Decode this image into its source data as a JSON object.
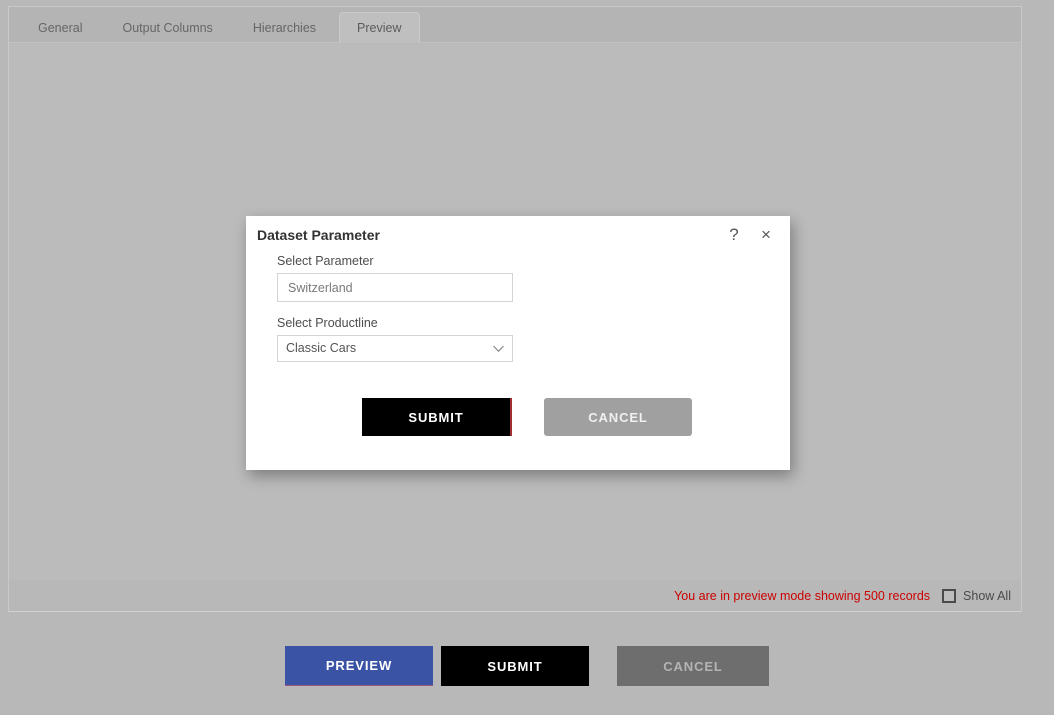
{
  "tabs": [
    {
      "label": "General",
      "active": false
    },
    {
      "label": "Output Columns",
      "active": false
    },
    {
      "label": "Hierarchies",
      "active": false
    },
    {
      "label": "Preview",
      "active": true
    }
  ],
  "status_bar": {
    "preview_message": "You are in preview mode showing 500 records",
    "show_all_label": "Show All",
    "show_all_checked": false,
    "message_color": "#cc0000"
  },
  "dialog": {
    "title": "Dataset Parameter",
    "help_icon": "?",
    "close_icon": "×",
    "fields": [
      {
        "label": "Select Parameter",
        "type": "text",
        "value": "Switzerland",
        "placeholder": "Switzerland"
      },
      {
        "label": "Select Productline",
        "type": "select",
        "value": "Classic Cars"
      }
    ],
    "buttons": {
      "submit": "SUBMIT",
      "cancel": "CANCEL"
    }
  },
  "footer": {
    "preview": "PREVIEW",
    "submit": "SUBMIT",
    "cancel": "CANCEL"
  },
  "colors": {
    "accent_blue": "#3b53a4",
    "submit_black": "#000000",
    "cancel_gray": "#6e6e6e",
    "dialog_cancel_gray": "#a0a0a0",
    "warning_red": "#cc0000",
    "page_bg": "#b8b8b8",
    "canvas_bg": "#bbbbbb"
  }
}
